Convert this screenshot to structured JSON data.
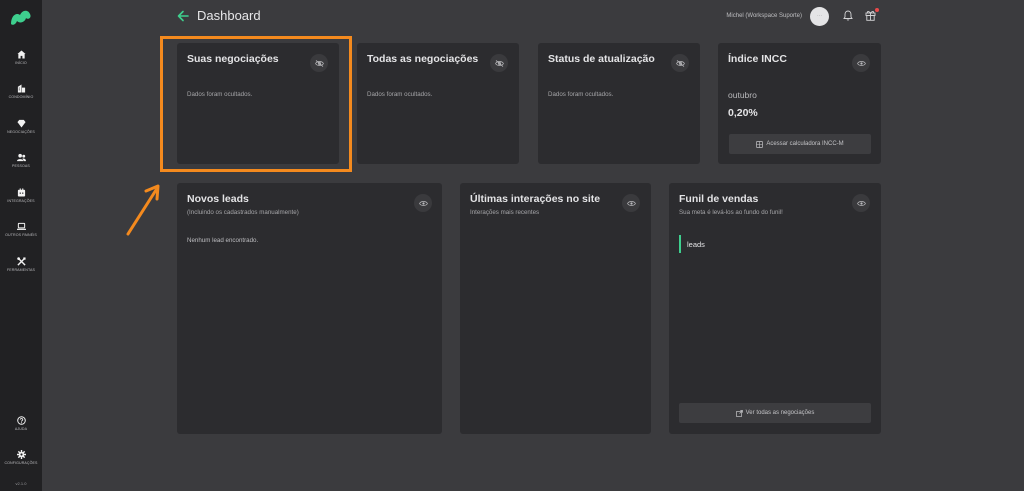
{
  "header": {
    "title": "Dashboard",
    "user_name": "Michel (Workspace Suporte)",
    "avatar_text": "···"
  },
  "sidebar": {
    "items": [
      {
        "label": "Início",
        "icon": "home-icon"
      },
      {
        "label": "Condomínio",
        "icon": "building-icon"
      },
      {
        "label": "Negociações",
        "icon": "diamond-icon"
      },
      {
        "label": "Pessoas",
        "icon": "users-icon"
      },
      {
        "label": "Integrações",
        "icon": "puzzle-icon"
      },
      {
        "label": "Outros painéis",
        "icon": "laptop-icon"
      },
      {
        "label": "Ferramentas",
        "icon": "tools-icon"
      }
    ],
    "bottom": [
      {
        "label": "Ajuda",
        "icon": "help-icon"
      },
      {
        "label": "Configurações",
        "icon": "gear-icon"
      }
    ],
    "version": "v2.1.0"
  },
  "cards": {
    "suas": {
      "title": "Suas negociações",
      "body": "Dados foram ocultados."
    },
    "todas": {
      "title": "Todas as negociações",
      "body": "Dados foram ocultados."
    },
    "status": {
      "title": "Status de atualização",
      "body": "Dados foram ocultados."
    },
    "incc": {
      "title": "Índice INCC",
      "month": "outubro",
      "value": "0,20%",
      "button": "Acessar calculadora INCC-M"
    },
    "leads": {
      "title": "Novos leads",
      "subtitle": "(Incluindo os cadastrados manualmente)",
      "empty": "Nenhum lead encontrado."
    },
    "interacoes": {
      "title": "Últimas interações no site",
      "subtitle": "Interações mais recentes"
    },
    "funil": {
      "title": "Funil de vendas",
      "subtitle": "Sua meta é levá-los ao fundo do funil!",
      "stage": "leads",
      "button": "Ver todas as negociações"
    }
  },
  "colors": {
    "background": "#3b3b3e",
    "sidebar": "#212123",
    "card": "#2c2c2f",
    "accent": "#3ecf8e",
    "annotation": "#f48a1e"
  }
}
